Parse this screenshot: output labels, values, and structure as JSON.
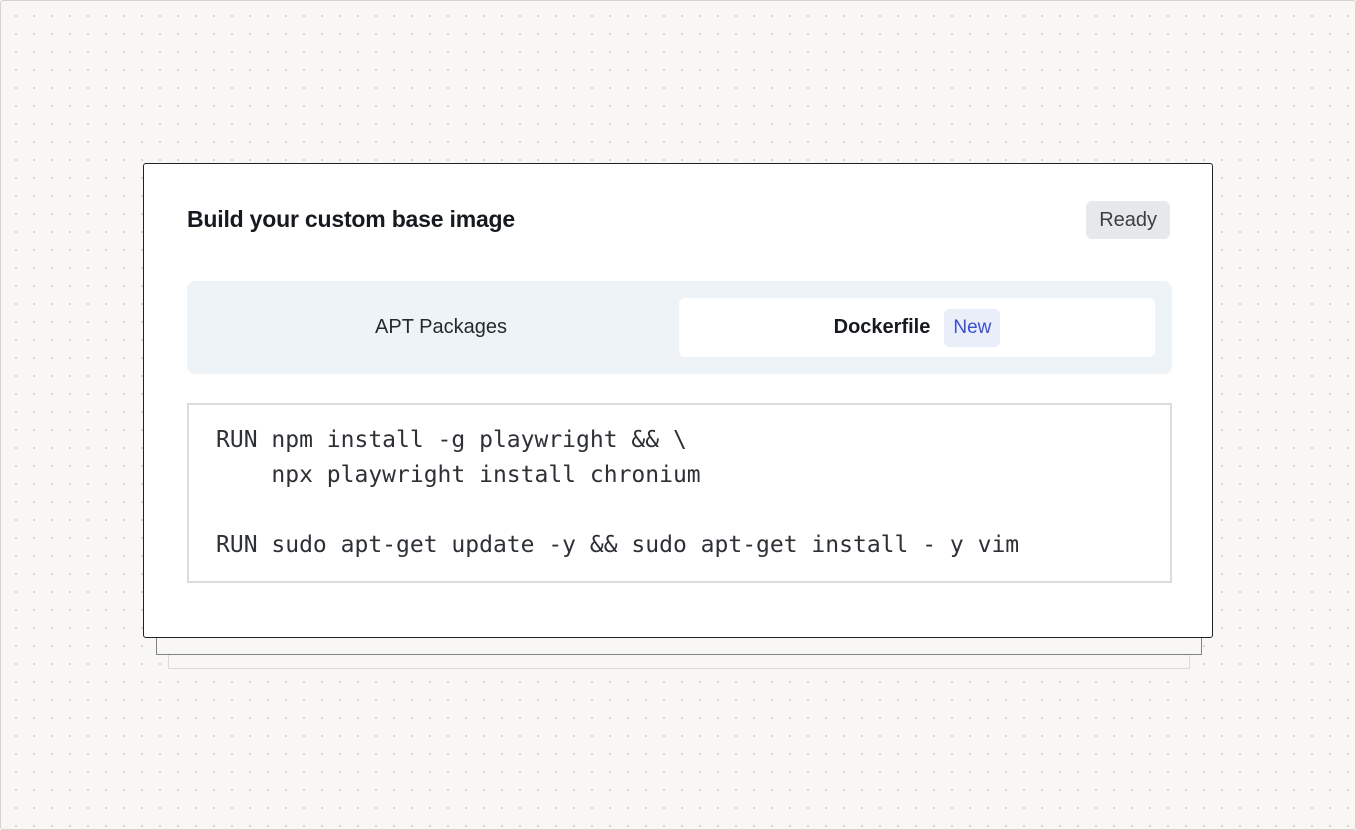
{
  "card": {
    "title": "Build your custom base image",
    "status": "Ready"
  },
  "tabs": {
    "apt_label": "APT Packages",
    "dockerfile_label": "Dockerfile",
    "dockerfile_badge": "New",
    "selected": "Dockerfile"
  },
  "code": {
    "lines": [
      "RUN npm install -g playwright && \\",
      "    npx playwright install chronium",
      "",
      "RUN sudo apt-get update -y && sudo apt-get install - y vim"
    ]
  },
  "colors": {
    "accent": "#3b4fd0",
    "badge_bg": "#e9eef8",
    "tabs_bg": "#eef3f7",
    "canvas_bg": "#f8f7f3"
  }
}
